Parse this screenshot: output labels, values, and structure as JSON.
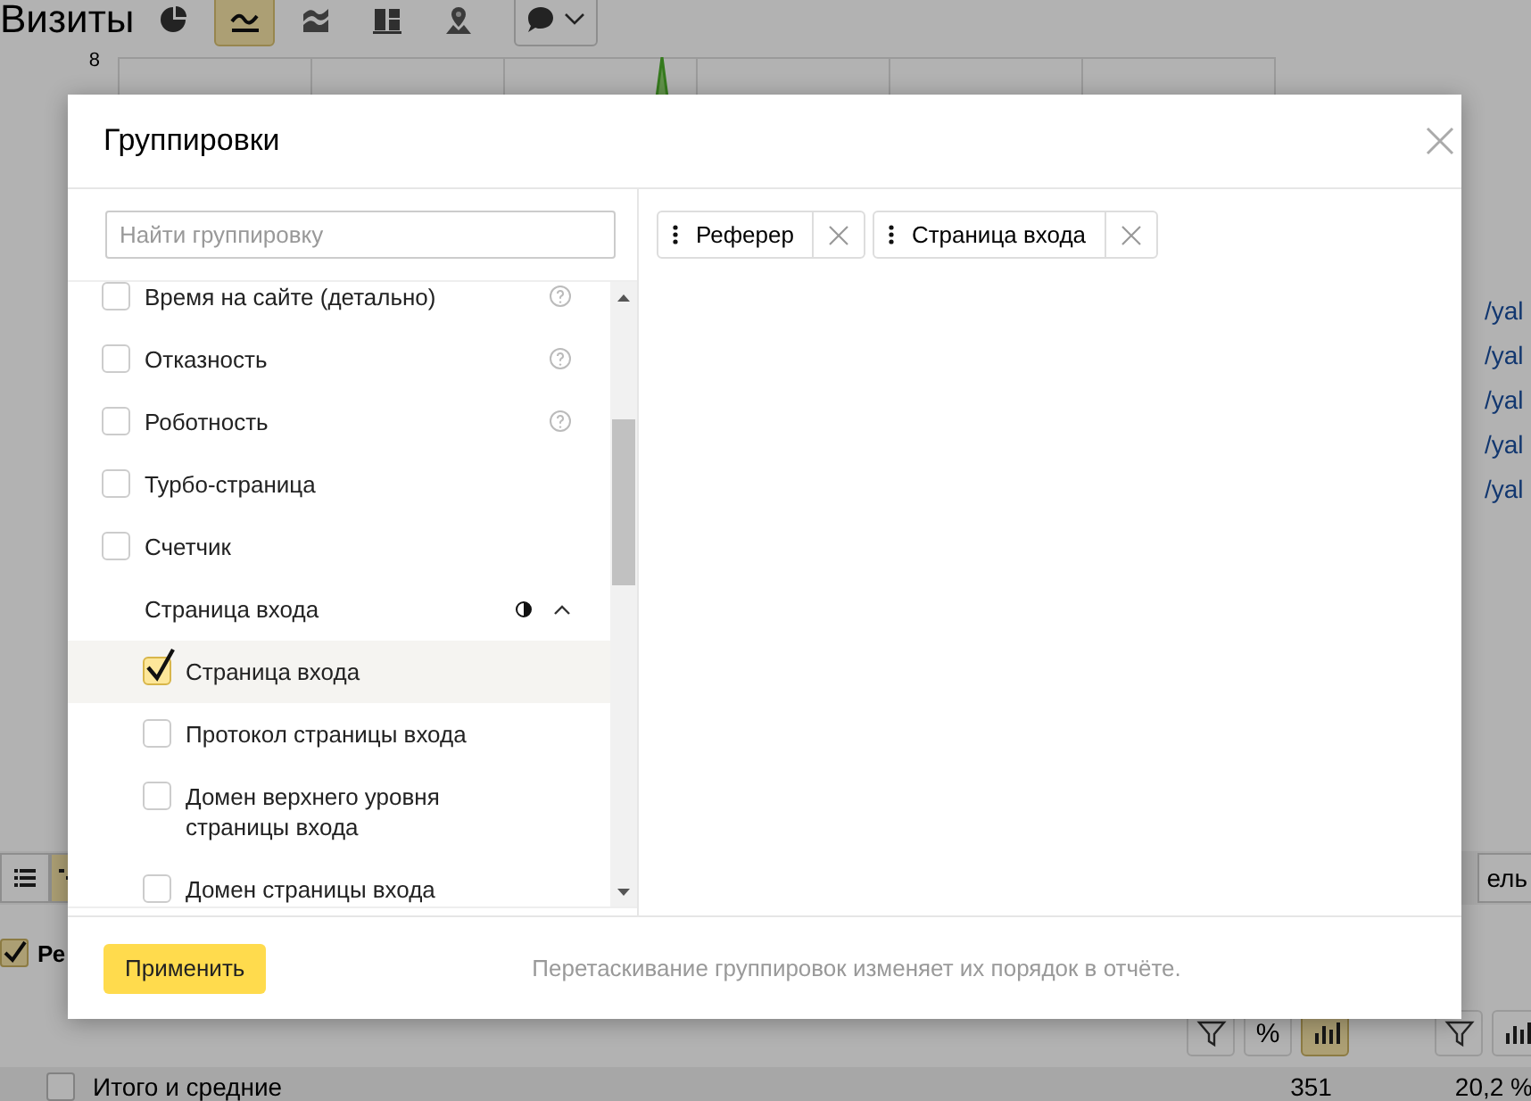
{
  "background": {
    "title": "Визиты",
    "view_buttons": [
      {
        "kind": "pie",
        "selected": false
      },
      {
        "kind": "line",
        "selected": true
      },
      {
        "kind": "area",
        "selected": false
      },
      {
        "kind": "bars",
        "selected": false
      },
      {
        "kind": "map",
        "selected": false
      }
    ],
    "axis_label": "8",
    "links": [
      "/yal",
      "/yal",
      "/yal",
      "/yal",
      "/yal"
    ],
    "table_button": "ель",
    "row": {
      "label": "Ре",
      "checked": true
    },
    "metric_columns": [
      {
        "tools": [
          {
            "kind": "filter",
            "selected": false
          },
          {
            "kind": "percent",
            "label": "%",
            "selected": false
          },
          {
            "kind": "bars",
            "selected": true
          }
        ]
      },
      {
        "tools": [
          {
            "kind": "filter",
            "selected": false
          },
          {
            "kind": "bars",
            "selected": false
          }
        ]
      }
    ],
    "totals": {
      "checked": false,
      "label": "Итого и средние",
      "values": [
        "351",
        "20,2 %"
      ]
    }
  },
  "dialog": {
    "title": "Группировки",
    "search": {
      "placeholder": "Найти группировку"
    },
    "items": [
      {
        "kind": "option",
        "label": "Время на сайте (детально)",
        "checked": false,
        "help": true
      },
      {
        "kind": "option",
        "label": "Отказность",
        "checked": false,
        "help": true
      },
      {
        "kind": "option",
        "label": "Роботность",
        "checked": false,
        "help": true
      },
      {
        "kind": "option",
        "label": "Турбо-страница",
        "checked": false,
        "help": false
      },
      {
        "kind": "option",
        "label": "Счетчик",
        "checked": false,
        "help": false
      },
      {
        "kind": "group",
        "label": "Страница входа",
        "expanded": true,
        "children": [
          {
            "label": "Страница входа",
            "checked": true,
            "selected": true
          },
          {
            "label": "Протокол страницы входа",
            "checked": false,
            "selected": false
          },
          {
            "label": "Домен верхнего уровня страницы входа",
            "checked": false,
            "selected": false
          },
          {
            "label": "Домен страницы входа",
            "checked": false,
            "selected": false
          }
        ]
      }
    ],
    "chosen": [
      {
        "label": "Реферер"
      },
      {
        "label": "Страница входа"
      }
    ],
    "apply_button": "Применить",
    "hint": "Перетаскивание группировок изменяет их порядок в отчёте."
  }
}
